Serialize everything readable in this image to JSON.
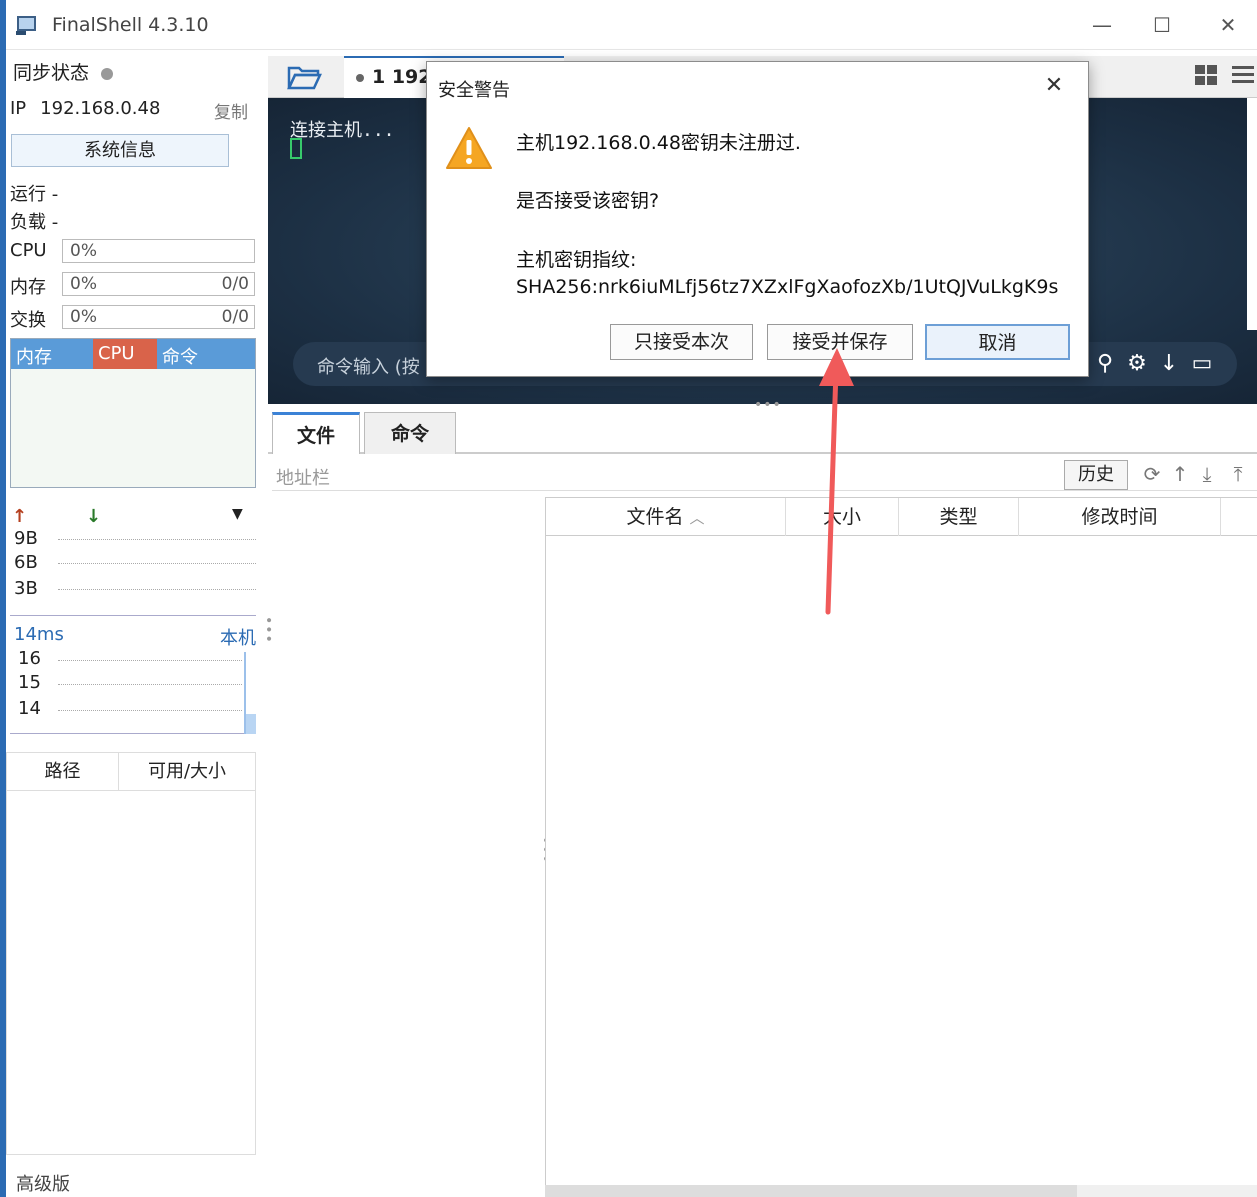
{
  "window": {
    "title": "FinalShell 4.3.10",
    "controls": {
      "minimize": "—",
      "maximize": "☐",
      "close": "✕"
    }
  },
  "sidebar": {
    "sync_label": "同步状态",
    "ip_label": "IP",
    "ip_value": "192.168.0.48",
    "copy_label": "复制",
    "sysinfo_button": "系统信息",
    "run_label": "运行 -",
    "load_label": "负载 -",
    "cpu": {
      "label": "CPU",
      "value": "0%"
    },
    "mem": {
      "label": "内存",
      "value": "0%",
      "ratio": "0/0"
    },
    "swap": {
      "label": "交换",
      "value": "0%",
      "ratio": "0/0"
    },
    "proc_tabs": [
      "内存",
      "CPU",
      "命令"
    ],
    "net_axis": [
      "9B",
      "6B",
      "3B"
    ],
    "ping_ms": "14ms",
    "ping_target": "本机",
    "ping_axis": [
      "16",
      "15",
      "14"
    ],
    "disk_headers": [
      "路径",
      "可用/大小"
    ],
    "edition": "高级版"
  },
  "terminal": {
    "tab_label": "1 192",
    "connecting_text": "连接主机...",
    "cmd_placeholder": "命令输入 (按"
  },
  "bottom": {
    "tabs": [
      "文件",
      "命令"
    ],
    "address_label": "地址栏",
    "history_button": "历史",
    "file_columns": [
      "文件名",
      "大小",
      "类型",
      "修改时间"
    ]
  },
  "dialog": {
    "title": "安全警告",
    "line1": "主机192.168.0.48密钥未注册过.",
    "line2": "是否接受该密钥?",
    "line3": "主机密钥指纹:",
    "fingerprint": "SHA256:nrk6iuMLfj56tz7XZxlFgXaofozXb/1UtQJVuLkgK9s",
    "buttons": {
      "accept_once": "只接受本次",
      "accept_save": "接受并保存",
      "cancel": "取消"
    }
  },
  "colors": {
    "accent": "#2b6bb3",
    "terminal_bg": "#1f3347",
    "cpu_tab": "#d9634a",
    "mem_tab": "#5a9bd8",
    "annotation_arrow": "#f05a5a",
    "warning": "#f5a623"
  }
}
